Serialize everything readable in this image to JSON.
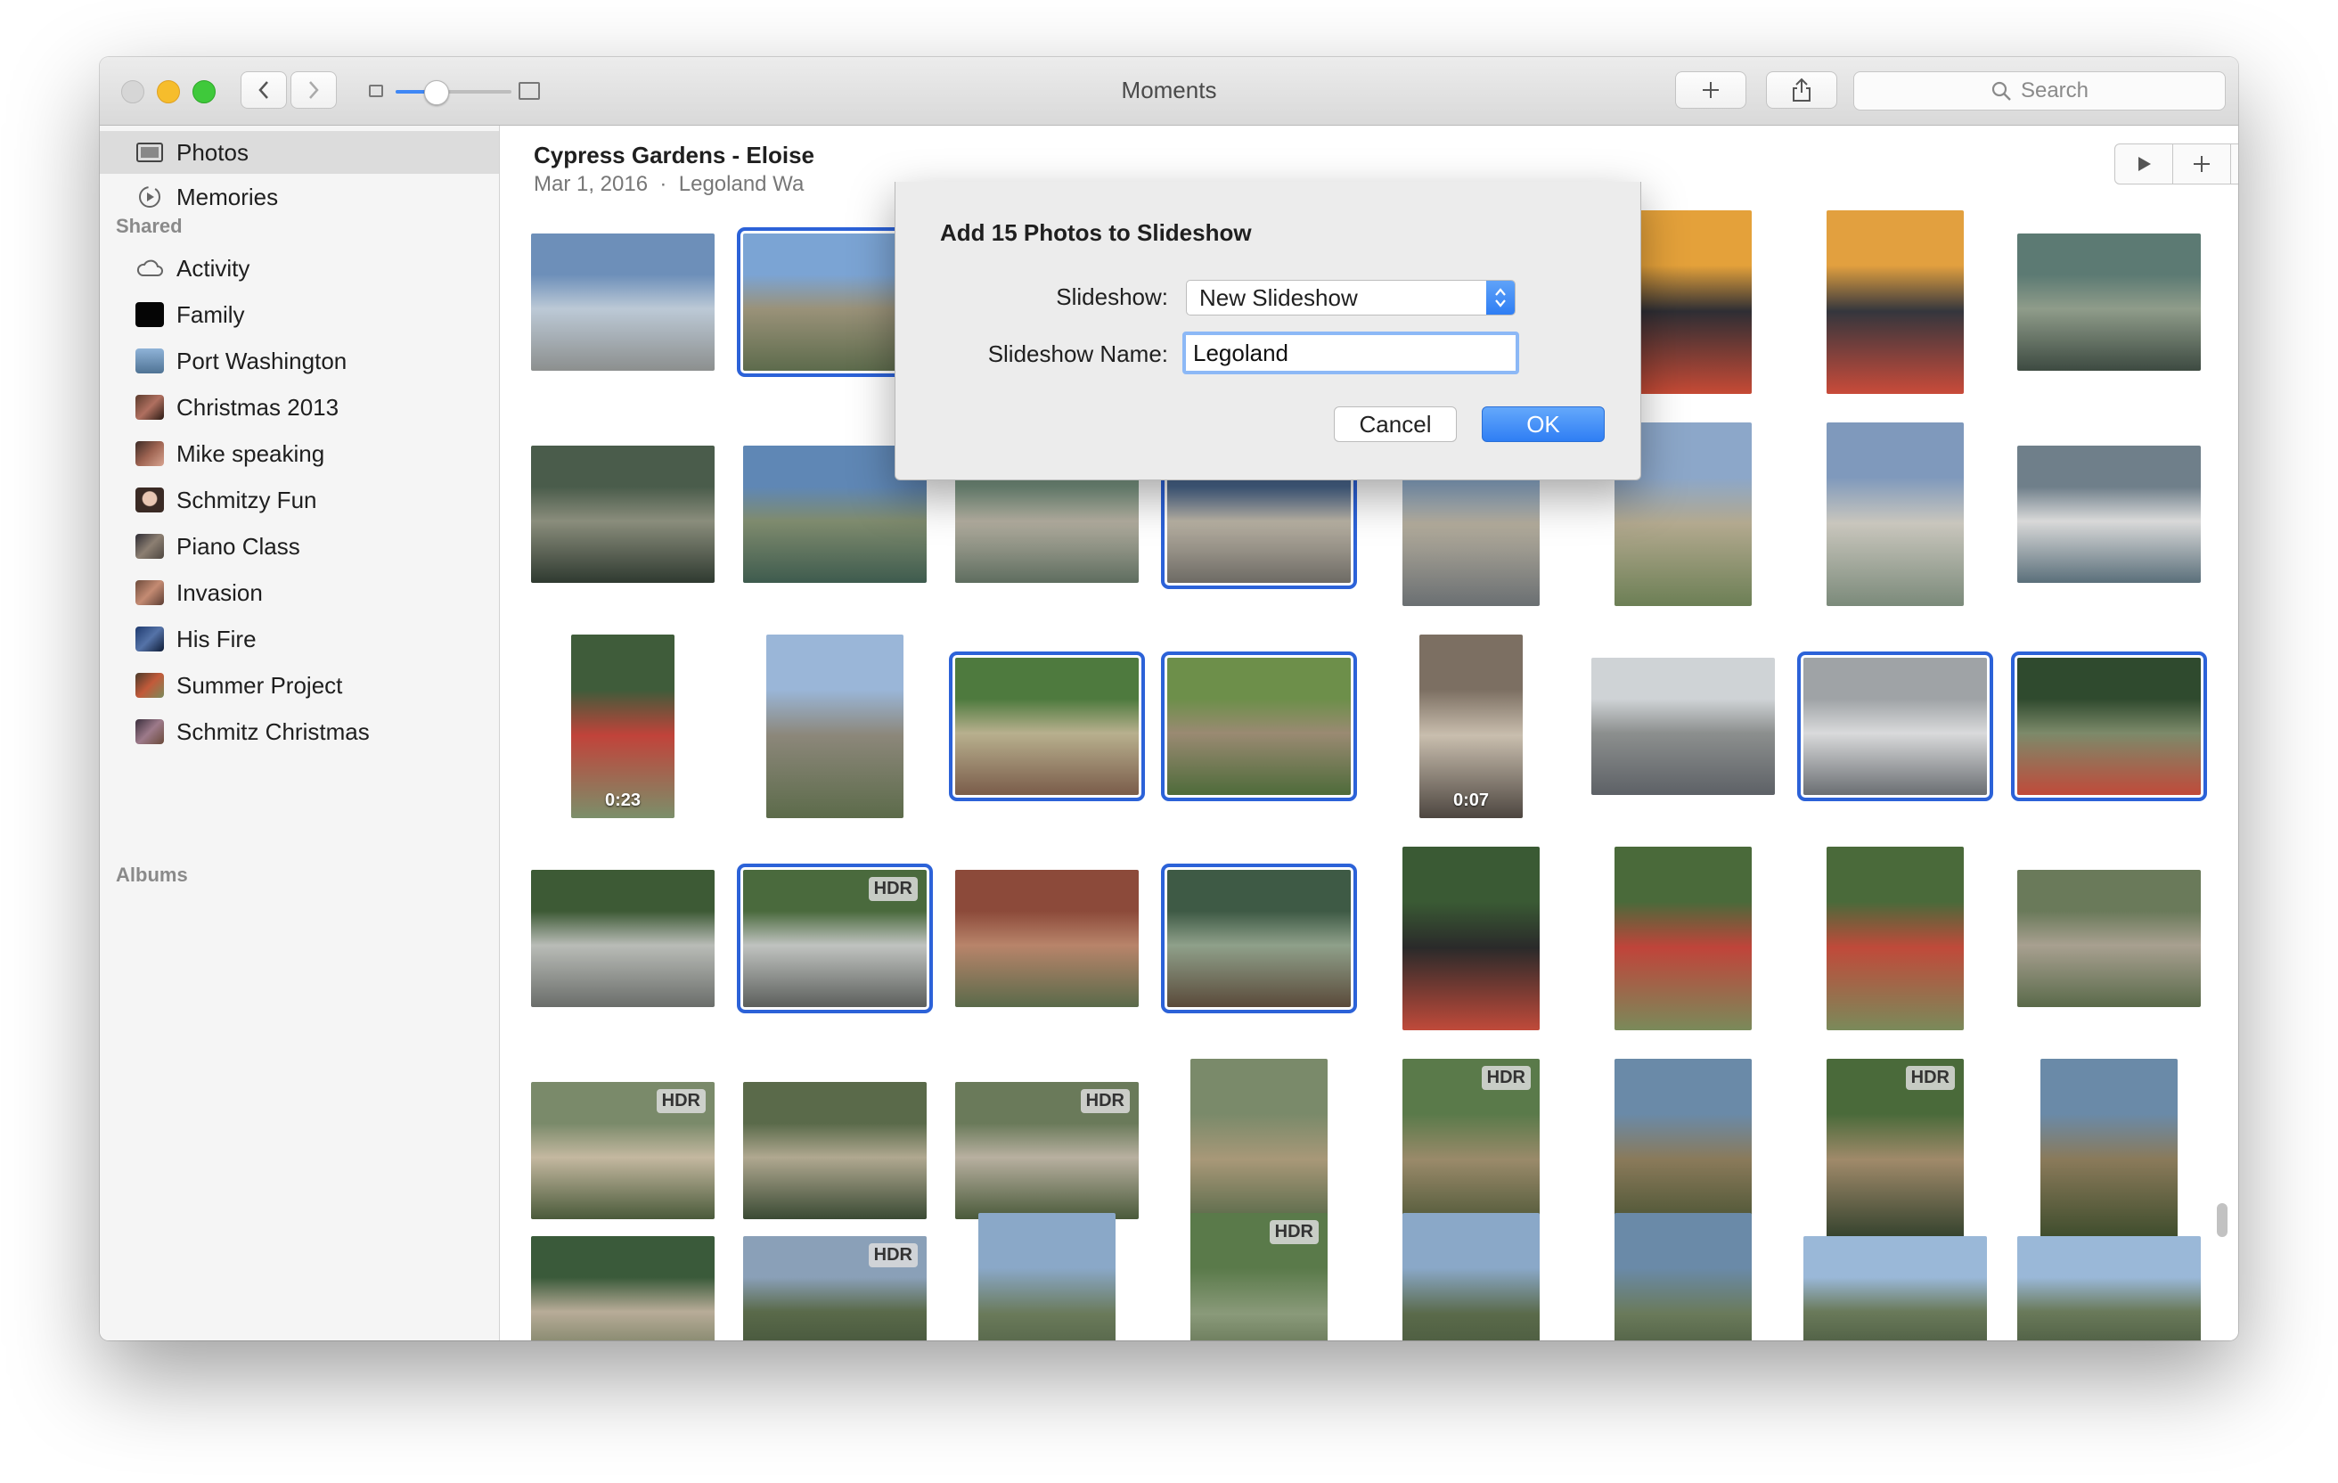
{
  "window": {
    "title": "Moments",
    "search_placeholder": "Search"
  },
  "sidebar": {
    "library_items": [
      {
        "label": "Photos",
        "icon": "photos-icon",
        "selected": true
      },
      {
        "label": "Memories",
        "icon": "memories-icon",
        "selected": false
      }
    ],
    "shared_header": "Shared",
    "shared_items": [
      {
        "label": "Activity",
        "icon": "cloud-icon"
      },
      {
        "label": "Family",
        "icon": "album-thumbnail-icon"
      },
      {
        "label": "Port Washington",
        "icon": "album-thumbnail-icon"
      },
      {
        "label": "Christmas 2013",
        "icon": "album-thumbnail-icon"
      },
      {
        "label": "Mike speaking",
        "icon": "album-thumbnail-icon"
      },
      {
        "label": "Schmitzy Fun",
        "icon": "album-thumbnail-icon"
      },
      {
        "label": "Piano Class",
        "icon": "album-thumbnail-icon"
      },
      {
        "label": "Invasion",
        "icon": "album-thumbnail-icon"
      },
      {
        "label": "His Fire",
        "icon": "album-thumbnail-icon"
      },
      {
        "label": "Summer Project",
        "icon": "album-thumbnail-icon"
      },
      {
        "label": "Schmitz Christmas",
        "icon": "album-thumbnail-icon"
      }
    ],
    "albums_header": "Albums"
  },
  "moment": {
    "title": "Cypress Gardens - Eloise",
    "date": "Mar 1, 2016",
    "location": "Legoland Wa"
  },
  "photos": {
    "selected": [
      1,
      11,
      18,
      19,
      22,
      23,
      25,
      27
    ],
    "badges": [
      {
        "index": 25,
        "text": "HDR"
      },
      {
        "index": 32,
        "text": "HDR"
      },
      {
        "index": 34,
        "text": "HDR"
      },
      {
        "index": 36,
        "text": "HDR"
      },
      {
        "index": 38,
        "text": "HDR"
      },
      {
        "index": 41,
        "text": "HDR"
      },
      {
        "index": 43,
        "text": "HDR"
      }
    ],
    "durations": [
      {
        "index": 16,
        "text": "0:23"
      },
      {
        "index": 20,
        "text": "0:07"
      }
    ]
  },
  "dialog": {
    "title": "Add 15 Photos to Slideshow",
    "slideshow_label": "Slideshow:",
    "slideshow_value": "New Slideshow",
    "name_label": "Slideshow Name:",
    "name_value": "Legoland",
    "cancel_label": "Cancel",
    "ok_label": "OK"
  },
  "colors": {
    "selection_border": "#2c62d8",
    "accent": "#3f87f5"
  }
}
